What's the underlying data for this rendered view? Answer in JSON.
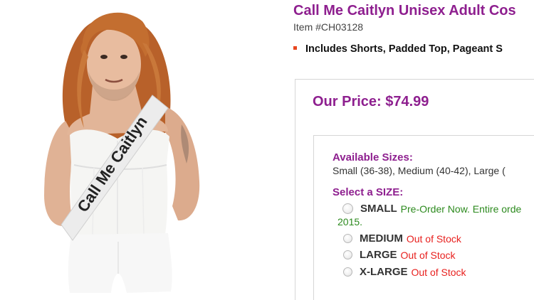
{
  "product": {
    "title": "Call Me Caitlyn Unisex Adult Cos",
    "item_number": "Item #CH03128",
    "feature": "Includes Shorts, Padded Top, Pageant S",
    "price_line": "Our Price: $74.99",
    "sash_text": "Call Me Caitlyn"
  },
  "sizes": {
    "available_label": "Available Sizes:",
    "available_list": "Small (36-38), Medium (40-42), Large (",
    "select_label": "Select a SIZE:",
    "options": [
      {
        "name": "SMALL",
        "status": "Pre-Order Now. Entire orde",
        "status_cont": "2015."
      },
      {
        "name": "MEDIUM",
        "status": "Out of Stock"
      },
      {
        "name": "LARGE",
        "status": "Out of Stock"
      },
      {
        "name": "X-LARGE",
        "status": "Out of Stock"
      }
    ]
  },
  "colors": {
    "brand_purple": "#8e1f8f",
    "preorder_green": "#2c8a1e",
    "out_of_stock_red": "#e8201e",
    "bullet_orange": "#e8461f"
  }
}
